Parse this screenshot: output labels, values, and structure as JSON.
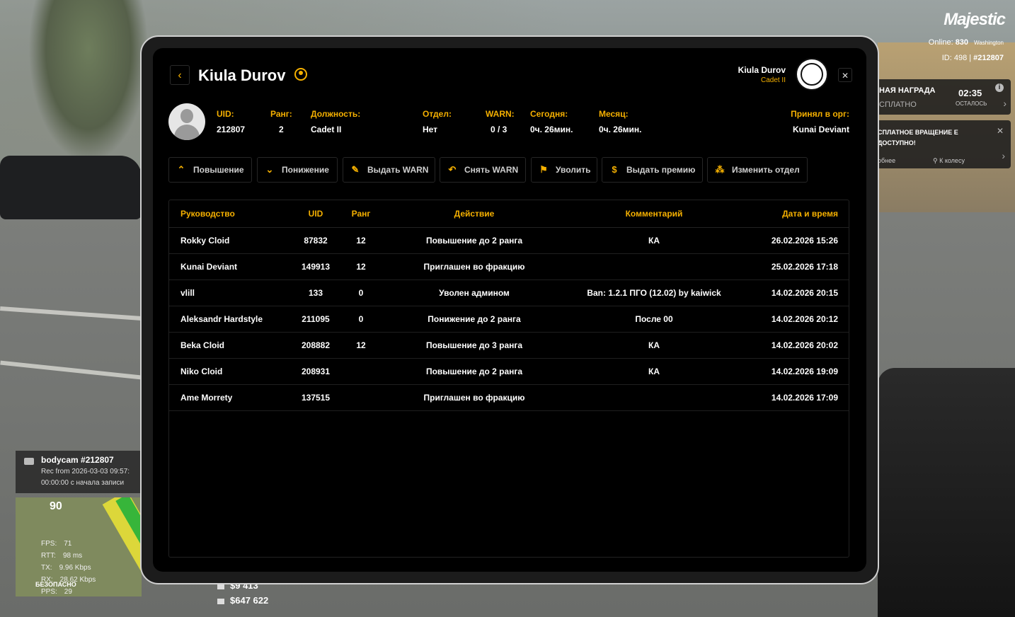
{
  "hud": {
    "logo": "Majestic",
    "online_label": "Online:",
    "online_value": "830",
    "server": "Washington",
    "id_label": "ID: 498 |",
    "id_value": "#212807",
    "reward_title": "НАЯ НАГРАДА",
    "reward_sub": "СПЛАТНО",
    "reward_time": "02:35",
    "reward_left": "ОСТАЛОСЬ",
    "spin_title": "СПЛАТНОЕ ВРАЩЕНИЕ Е ДОСТУПНО!",
    "spin_more": "обнее",
    "spin_wheel": "К колесу",
    "bodycam_title": "bodycam #212807",
    "bodycam_rec": "Rec from 2026-03-03 09:57:",
    "bodycam_time": "00:00:00 с начала записи",
    "speed": "90",
    "fps_label": "FPS:",
    "fps": "71",
    "rtt_label": "RTT:",
    "rtt": "98 ms",
    "tx_label": "TX:",
    "tx": "9.96 Kbps",
    "rx_label": "RX:",
    "rx": "28.62 Kbps",
    "pps_label": "PPS:",
    "pps": "29",
    "safe": "БЕЗОПАСНО",
    "money_cash": "$9 413",
    "money_bank": "$647 622"
  },
  "header": {
    "name": "Kiula Durov",
    "user_name": "Kiula Durov",
    "user_rank": "Cadet II"
  },
  "info": {
    "uid_label": "UID:",
    "uid": "212807",
    "rank_label": "Ранг:",
    "rank": "2",
    "position_label": "Должность:",
    "position": "Cadet II",
    "dept_label": "Отдел:",
    "dept": "Нет",
    "warn_label": "WARN:",
    "warn": "0 / 3",
    "today_label": "Сегодня:",
    "today": "0ч. 26мин.",
    "month_label": "Месяц:",
    "month": "0ч. 26мин.",
    "hired_label": "Принял в орг:",
    "hired": "Kunai Deviant"
  },
  "actions": {
    "promote": "Повышение",
    "demote": "Понижение",
    "give_warn": "Выдать WARN",
    "remove_warn": "Снять WARN",
    "fire": "Уволить",
    "bonus": "Выдать премию",
    "change_dept": "Изменить отдел"
  },
  "table": {
    "headers": {
      "leader": "Руководство",
      "uid": "UID",
      "rank": "Ранг",
      "action": "Действие",
      "comment": "Комментарий",
      "datetime": "Дата и время"
    },
    "rows": [
      {
        "leader": "Rokky Cloid",
        "uid": "87832",
        "rank": "12",
        "action": "Повышение до 2 ранга",
        "comment": "КА",
        "datetime": "26.02.2026 15:26"
      },
      {
        "leader": "Kunai Deviant",
        "uid": "149913",
        "rank": "12",
        "action": "Приглашен во фракцию",
        "comment": "",
        "datetime": "25.02.2026 17:18"
      },
      {
        "leader": "vlill",
        "uid": "133",
        "rank": "0",
        "action": "Уволен админом",
        "comment": "Ban: 1.2.1 ПГО (12.02) by kaiwick",
        "datetime": "14.02.2026 20:15"
      },
      {
        "leader": "Aleksandr Hardstyle",
        "uid": "211095",
        "rank": "0",
        "action": "Понижение до 2 ранга",
        "comment": "После 00",
        "datetime": "14.02.2026 20:12"
      },
      {
        "leader": "Beka Cloid",
        "uid": "208882",
        "rank": "12",
        "action": "Повышение до 3 ранга",
        "comment": "КА",
        "datetime": "14.02.2026 20:02"
      },
      {
        "leader": "Niko Cloid",
        "uid": "208931",
        "rank": "",
        "action": "Повышение до 2 ранга",
        "comment": "КА",
        "datetime": "14.02.2026 19:09"
      },
      {
        "leader": "Ame Morrety",
        "uid": "137515",
        "rank": "",
        "action": "Приглашен во фракцию",
        "comment": "",
        "datetime": "14.02.2026 17:09"
      }
    ]
  },
  "colors": {
    "accent": "#f5b000",
    "panel_bg": "#000000",
    "border": "#222222"
  },
  "icons": [
    "chevron-left-icon",
    "crown-icon",
    "close-icon",
    "chevron-up-icon",
    "chevron-down-icon",
    "warn-doc-icon",
    "undo-icon",
    "fire-person-icon",
    "coin-icon",
    "org-chart-icon"
  ]
}
